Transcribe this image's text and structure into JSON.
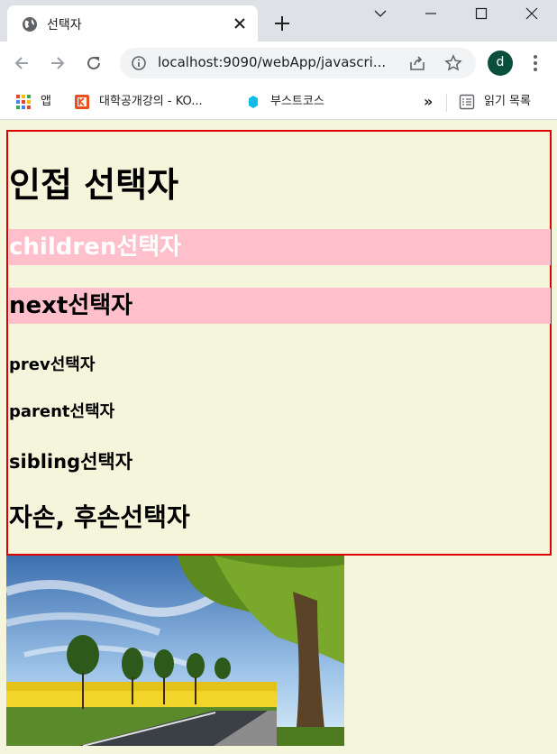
{
  "browser": {
    "tab": {
      "title": "선택자"
    },
    "url": "localhost:9090/webApp/javascri...",
    "profile_initial": "d"
  },
  "bookmarks": [
    {
      "label": "앱"
    },
    {
      "label": "대학공개강의 - KO..."
    },
    {
      "label": "부스트코스"
    }
  ],
  "reading_list": {
    "label": "읽기 목록"
  },
  "content": {
    "title": "인접 선택자",
    "items": [
      "children선택자",
      "next선택자",
      "prev선택자",
      "parent선택자",
      "sibling선택자",
      "자손, 후손선택자"
    ]
  },
  "colors": {
    "page_bg": "#f5f5dc",
    "box_border": "#e00000",
    "highlight_bg": "#ffc0cb"
  }
}
